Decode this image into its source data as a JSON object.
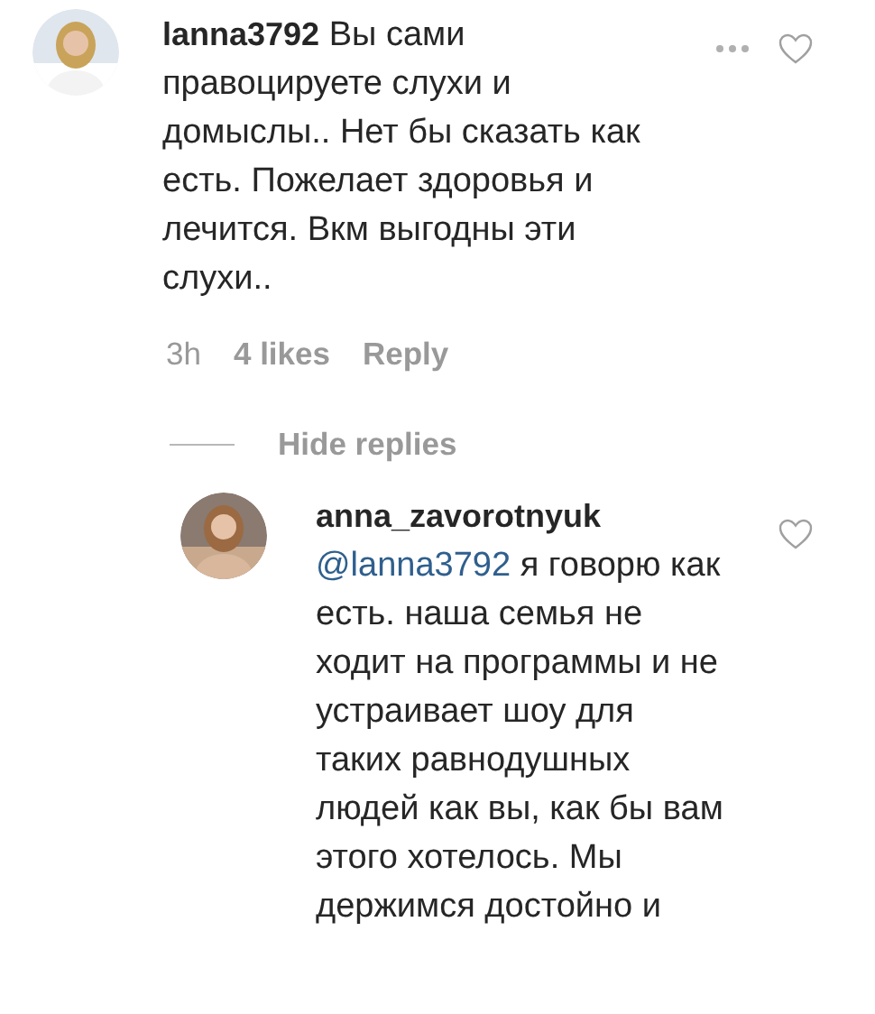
{
  "comment": {
    "username": "lanna3792",
    "text": "Вы сами правоцируете слухи и домыслы.. Нет бы сказать как есть. Пожелает здоровья и лечится. Вкм выгодны эти слухи..",
    "liked": false,
    "time": "3h",
    "likes": "4 likes",
    "reply": "Reply"
  },
  "hide_replies": "Hide replies",
  "reply": {
    "username": "anna_zavorotnyuk",
    "mention": "@lanna3792",
    "text": "я говорю как есть. наша семья не ходит на программы и не устраивает шоу для таких равнодушных людей как вы, как бы вам этого хотелось. Мы держимся достойно и",
    "liked": false
  }
}
